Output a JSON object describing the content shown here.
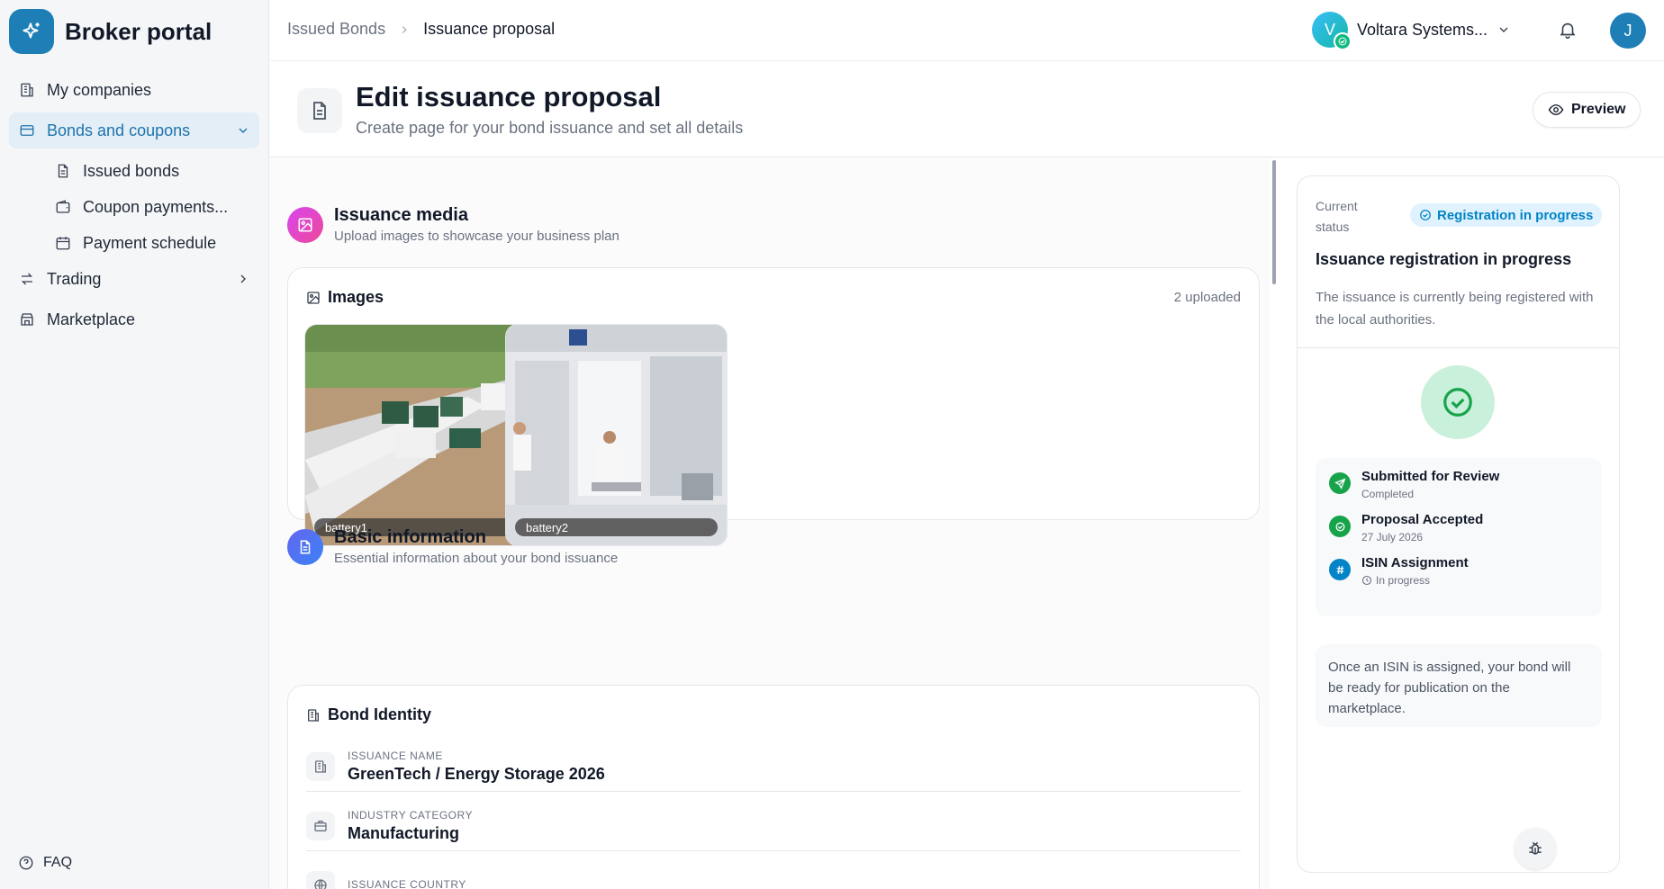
{
  "app": {
    "name": "Broker portal"
  },
  "sidebar": {
    "items": [
      {
        "label": "My companies"
      },
      {
        "label": "Bonds and coupons",
        "children": [
          {
            "label": "Issued bonds"
          },
          {
            "label": "Coupon payments..."
          },
          {
            "label": "Payment schedule"
          }
        ]
      },
      {
        "label": "Trading"
      },
      {
        "label": "Marketplace"
      }
    ],
    "faq": "FAQ"
  },
  "topbar": {
    "breadcrumb": [
      "Issued Bonds",
      "Issuance proposal"
    ],
    "company": {
      "initial": "V",
      "name": "Voltara Systems..."
    },
    "user_initial": "J"
  },
  "page": {
    "title": "Edit issuance proposal",
    "subtitle": "Create page for your bond issuance and set all details",
    "preview_label": "Preview"
  },
  "media": {
    "title": "Issuance media",
    "subtitle": "Upload images to showcase your business plan",
    "card_title": "Images",
    "count": "2 uploaded",
    "images": [
      {
        "label": "battery1"
      },
      {
        "label": "battery2"
      }
    ]
  },
  "basic": {
    "title": "Basic information",
    "subtitle": "Essential information about your bond issuance",
    "card_title": "Bond Identity",
    "fields": [
      {
        "label": "ISSUANCE NAME",
        "value": "GreenTech / Energy Storage 2026",
        "icon": "building-icon"
      },
      {
        "label": "INDUSTRY CATEGORY",
        "value": "Manufacturing",
        "icon": "briefcase-icon"
      },
      {
        "label": "ISSUANCE COUNTRY",
        "value": "",
        "icon": "globe-icon"
      }
    ]
  },
  "status": {
    "current_label": "Current status",
    "badge": "Registration in progress",
    "title": "Issuance registration in progress",
    "description": "The issuance is currently being registered with the local authorities.",
    "steps": [
      {
        "title": "Submitted for Review",
        "meta": "Completed",
        "color": "#16a34a"
      },
      {
        "title": "Proposal Accepted",
        "meta": "27 July 2026",
        "color": "#16a34a"
      },
      {
        "title": "ISIN Assignment",
        "meta": "In progress",
        "color": "#0284c7"
      }
    ],
    "note": "Once an ISIN is assigned, your bond will be ready for publication on the marketplace."
  },
  "colors": {
    "accent": "#1d7fb6",
    "success": "#16a34a",
    "info": "#0284c7"
  }
}
